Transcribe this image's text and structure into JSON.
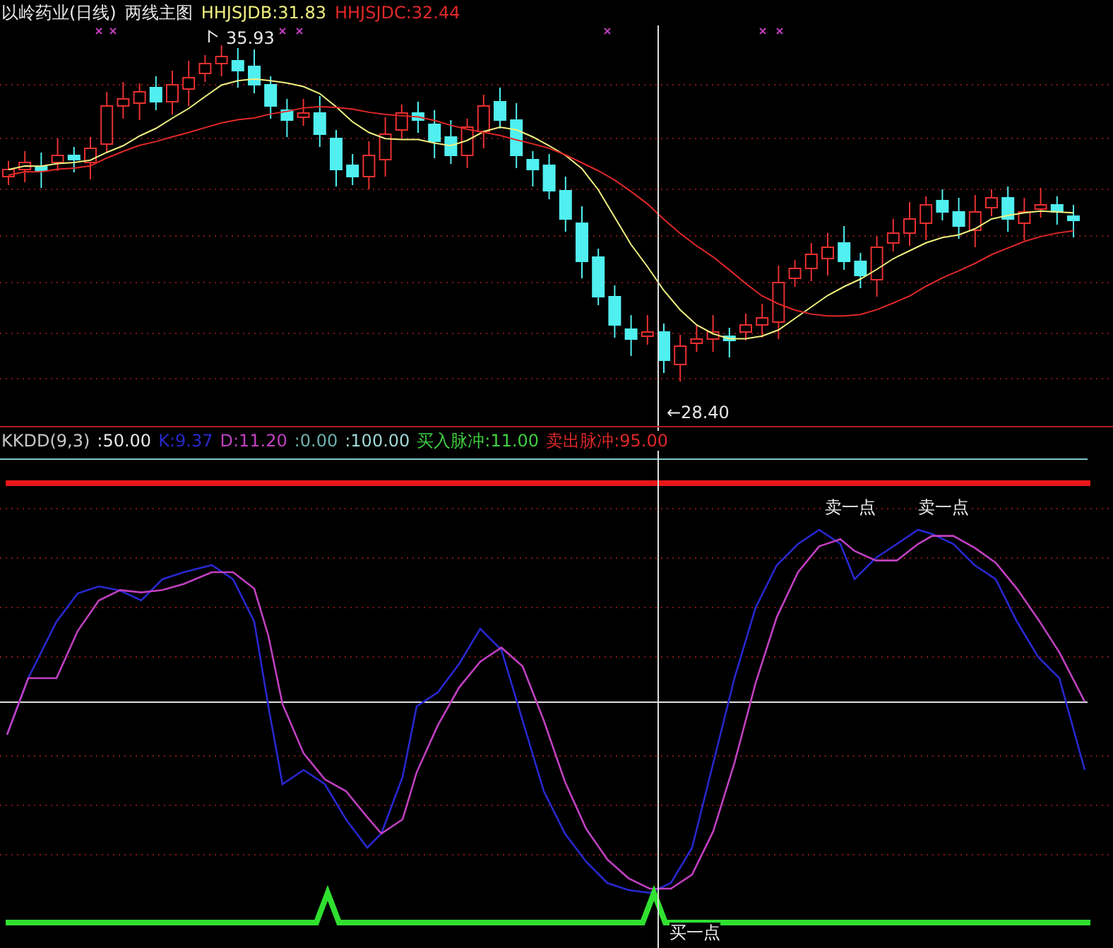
{
  "main_panel": {
    "title": "以岭药业(日线)",
    "indicator_name": "两线主图",
    "legend": [
      {
        "label": "HHJSJDB:31.83",
        "color": "#f0f080"
      },
      {
        "label": "HHJSJDC:32.44",
        "color": "#e02828"
      }
    ],
    "high_label": "35.93",
    "low_label": "←28.40"
  },
  "sub_panel": {
    "legend": [
      {
        "label": "KKDD(9,3)",
        "color": "#c8c8c8"
      },
      {
        "label": ":50.00",
        "color": "#e8e8e8"
      },
      {
        "label": "K:9.37",
        "color": "#2828c8"
      },
      {
        "label": "D:11.20",
        "color": "#c040c0"
      },
      {
        "label": ":0.00",
        "color": "#70b0b0"
      },
      {
        "label": ":100.00",
        "color": "#a0d8d8"
      },
      {
        "label": "买入脉冲:11.00",
        "color": "#40d040"
      },
      {
        "label": "卖出脉冲:95.00",
        "color": "#e02828"
      }
    ],
    "annotations": [
      {
        "label": "卖一点",
        "kind": "sell"
      },
      {
        "label": "卖一点",
        "kind": "sell"
      },
      {
        "label": "买一点",
        "kind": "buy"
      }
    ]
  }
}
